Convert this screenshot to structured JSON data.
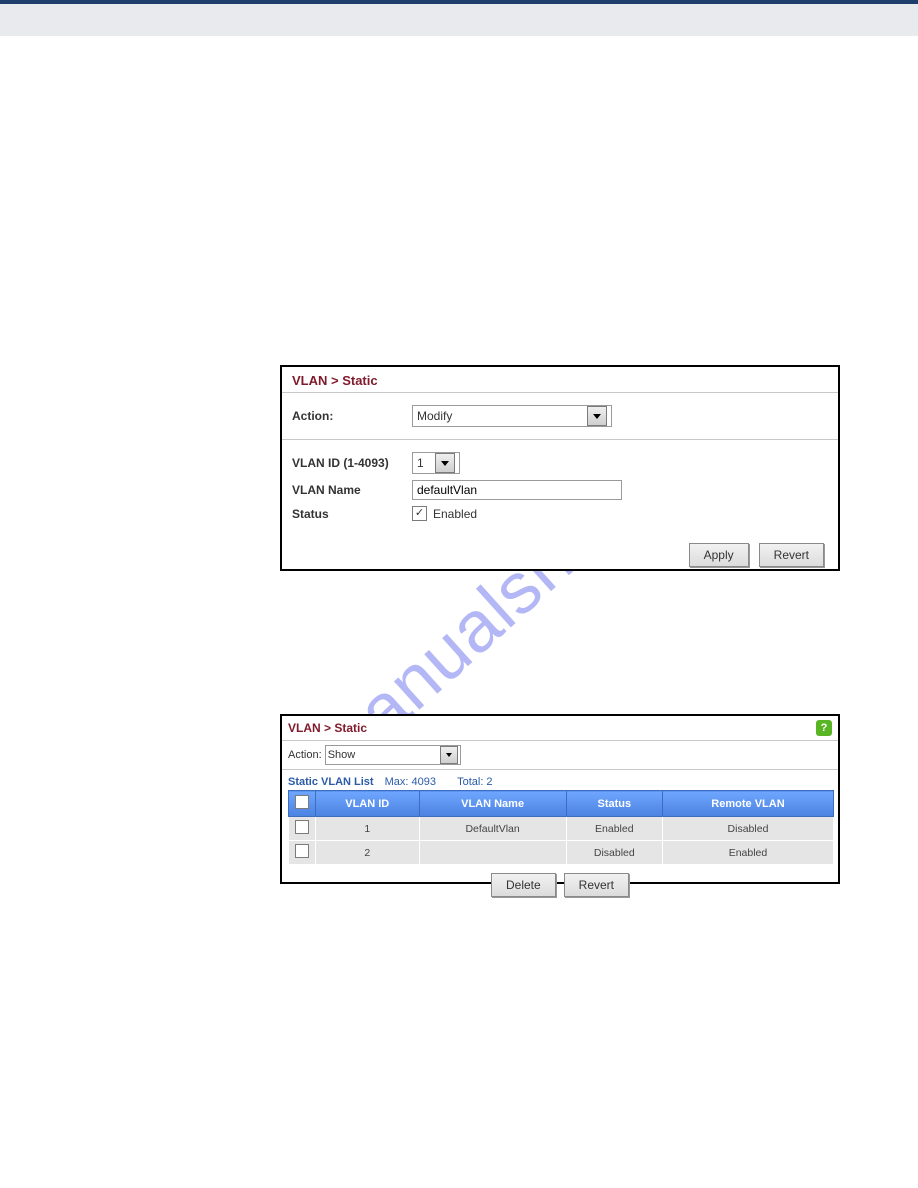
{
  "panel1": {
    "breadcrumb": "VLAN > Static",
    "action_label": "Action:",
    "action_value": "Modify",
    "vlan_id_label": "VLAN ID (1-4093)",
    "vlan_id_value": "1",
    "vlan_name_label": "VLAN Name",
    "vlan_name_value": "defaultVlan",
    "status_label": "Status",
    "status_value": "Enabled",
    "apply": "Apply",
    "revert": "Revert"
  },
  "panel2": {
    "breadcrumb": "VLAN > Static",
    "action_label": "Action:",
    "action_value": "Show",
    "list_title": "Static VLAN List",
    "max_label": "Max: 4093",
    "total_label": "Total: 2",
    "columns": {
      "vlan_id": "VLAN ID",
      "vlan_name": "VLAN Name",
      "status": "Status",
      "remote": "Remote VLAN"
    },
    "rows": [
      {
        "id": "1",
        "name": "DefaultVlan",
        "status": "Enabled",
        "remote": "Disabled"
      },
      {
        "id": "2",
        "name": "",
        "status": "Disabled",
        "remote": "Enabled"
      }
    ],
    "delete": "Delete",
    "revert": "Revert"
  },
  "watermark": "manualshive.com"
}
